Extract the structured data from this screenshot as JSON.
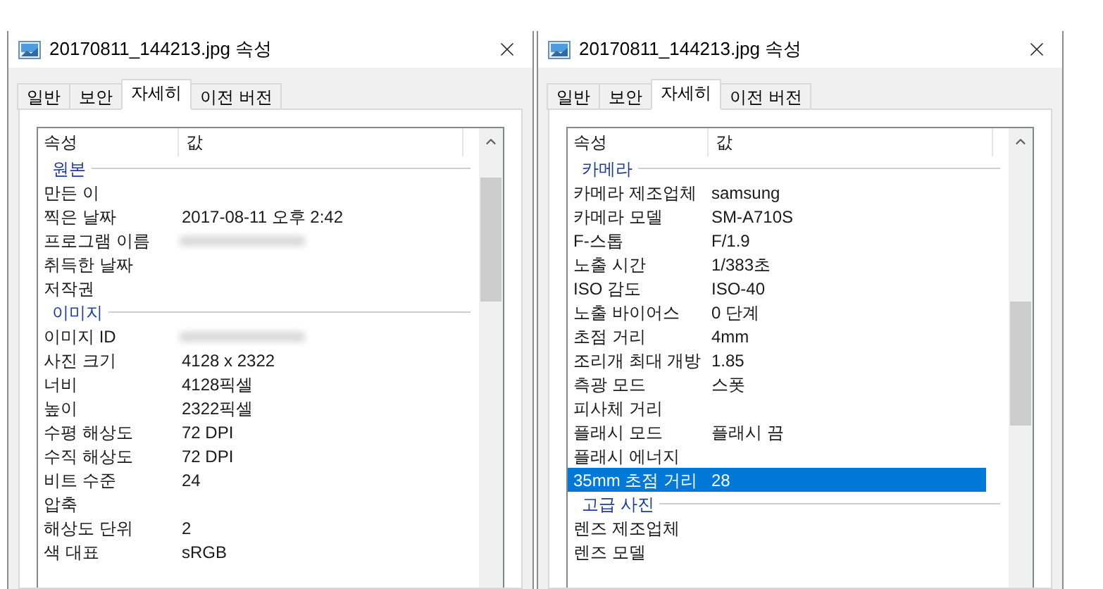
{
  "windows": [
    {
      "title": "20170811_144213.jpg 속성",
      "tabs": [
        {
          "label": "일반",
          "selected": false
        },
        {
          "label": "보안",
          "selected": false
        },
        {
          "label": "자세히",
          "selected": true
        },
        {
          "label": "이전 버전",
          "selected": false
        }
      ],
      "columns": [
        "속성",
        "값"
      ],
      "rows": [
        {
          "kind": "group",
          "label": "원본"
        },
        {
          "kind": "item",
          "name": "만든 이",
          "selected": false
        },
        {
          "kind": "item",
          "name": "찍은 날짜",
          "value": "2017-08-11 오후 2:42",
          "selected": false
        },
        {
          "kind": "item",
          "name": "프로그램 이름",
          "blurred": true,
          "selected": false
        },
        {
          "kind": "item",
          "name": "취득한 날짜",
          "selected": false
        },
        {
          "kind": "item",
          "name": "저작권",
          "selected": false
        },
        {
          "kind": "group",
          "label": "이미지"
        },
        {
          "kind": "item",
          "name": "이미지 ID",
          "blurred": true,
          "selected": false
        },
        {
          "kind": "item",
          "name": "사진 크기",
          "value": "4128 x 2322",
          "selected": false
        },
        {
          "kind": "item",
          "name": "너비",
          "value": "4128픽셀",
          "selected": false
        },
        {
          "kind": "item",
          "name": "높이",
          "value": "2322픽셀",
          "selected": false
        },
        {
          "kind": "item",
          "name": "수평 해상도",
          "value": "72 DPI",
          "selected": false
        },
        {
          "kind": "item",
          "name": "수직 해상도",
          "value": "72 DPI",
          "selected": false
        },
        {
          "kind": "item",
          "name": "비트 수준",
          "value": "24",
          "selected": false
        },
        {
          "kind": "item",
          "name": "압축",
          "selected": false
        },
        {
          "kind": "item",
          "name": "해상도 단위",
          "value": "2",
          "selected": false
        },
        {
          "kind": "item",
          "name": "색 대표",
          "value": "sRGB",
          "selected": false
        }
      ]
    },
    {
      "title": "20170811_144213.jpg 속성",
      "tabs": [
        {
          "label": "일반",
          "selected": false
        },
        {
          "label": "보안",
          "selected": false
        },
        {
          "label": "자세히",
          "selected": true
        },
        {
          "label": "이전 버전",
          "selected": false
        }
      ],
      "columns": [
        "속성",
        "값"
      ],
      "rows": [
        {
          "kind": "group",
          "label": "카메라"
        },
        {
          "kind": "item",
          "name": "카메라 제조업체",
          "value": "samsung",
          "selected": false
        },
        {
          "kind": "item",
          "name": "카메라 모델",
          "value": "SM-A710S",
          "selected": false
        },
        {
          "kind": "item",
          "name": "F-스톱",
          "value": "F/1.9",
          "selected": false
        },
        {
          "kind": "item",
          "name": "노출 시간",
          "value": "1/383초",
          "selected": false
        },
        {
          "kind": "item",
          "name": "ISO 감도",
          "value": "ISO-40",
          "selected": false
        },
        {
          "kind": "item",
          "name": "노출 바이어스",
          "value": "0 단계",
          "selected": false
        },
        {
          "kind": "item",
          "name": "초점 거리",
          "value": "4mm",
          "selected": false
        },
        {
          "kind": "item",
          "name": "조리개 최대 개방",
          "value": "1.85",
          "selected": false
        },
        {
          "kind": "item",
          "name": "측광 모드",
          "value": "스폿",
          "selected": false
        },
        {
          "kind": "item",
          "name": "피사체 거리",
          "selected": false
        },
        {
          "kind": "item",
          "name": "플래시 모드",
          "value": "플래시 끔",
          "selected": false
        },
        {
          "kind": "item",
          "name": "플래시 에너지",
          "selected": false
        },
        {
          "kind": "item",
          "name": "35mm 초점 거리",
          "value": "28",
          "selected": true
        },
        {
          "kind": "group",
          "label": "고급 사진"
        },
        {
          "kind": "item",
          "name": "렌즈 제조업체",
          "selected": false
        },
        {
          "kind": "item",
          "name": "렌즈 모델",
          "selected": false
        }
      ]
    }
  ]
}
